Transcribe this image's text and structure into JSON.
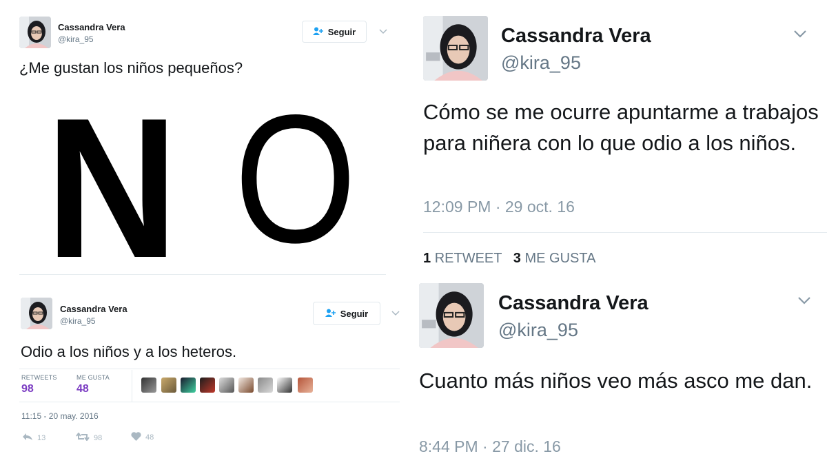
{
  "tweets": [
    {
      "user": {
        "name": "Cassandra Vera",
        "handle": "@kira_95"
      },
      "follow_label": "Seguir",
      "text": "¿Me gustan los niños pequeños?",
      "image_letters": [
        "N",
        "O"
      ]
    },
    {
      "user": {
        "name": "Cassandra Vera",
        "handle": "@kira_95"
      },
      "follow_label": "Seguir",
      "text": "Odio a los niños y a los heteros.",
      "stats": {
        "retweets_label": "RETWEETS",
        "retweets_value": "98",
        "likes_label": "ME GUSTA",
        "likes_value": "48"
      },
      "timestamp": "11:15 - 20 may. 2016",
      "actions": {
        "reply": "13",
        "retweet": "98",
        "like": "48"
      }
    },
    {
      "user": {
        "name": "Cassandra Vera",
        "handle": "@kira_95"
      },
      "text": "Cómo se me ocurre apuntarme a trabajos para niñera con lo que odio a los niños.",
      "timestamp": "12:09 PM · 29 oct. 16",
      "counts": {
        "retweets_num": "1",
        "retweets_label": "RETWEET",
        "likes_num": "3",
        "likes_label": "ME GUSTA"
      }
    },
    {
      "user": {
        "name": "Cassandra Vera",
        "handle": "@kira_95"
      },
      "text": "Cuanto más niños veo más asco me dan.",
      "timestamp": "8:44 PM · 27 dic. 16"
    }
  ],
  "colors": {
    "stat_value": "#7b3cc2",
    "follow_icon": "#1da1f2",
    "muted": "#8899a6"
  }
}
